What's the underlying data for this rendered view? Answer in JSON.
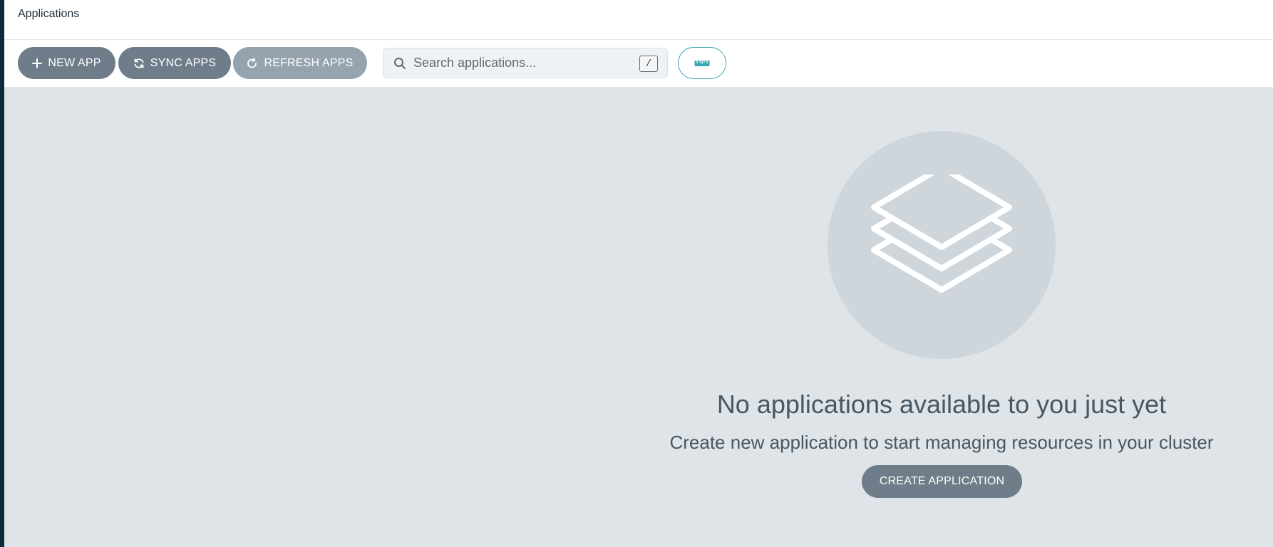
{
  "header": {
    "title": "Applications"
  },
  "toolbar": {
    "new_app_label": "NEW APP",
    "sync_apps_label": "SYNC APPS",
    "refresh_apps_label": "REFRESH APPS",
    "search": {
      "placeholder": "Search applications...",
      "value": "",
      "shortcut_hint": "/"
    },
    "ruler_icon": "ruler-icon"
  },
  "empty_state": {
    "icon": "layers-icon",
    "title": "No applications available to you just yet",
    "subtitle": "Create new application to start managing resources in your cluster",
    "create_label": "CREATE APPLICATION"
  },
  "colors": {
    "primary_button": "#6e7d89",
    "disabled_button": "#95a3ae",
    "accent": "#3aa6b9",
    "background": "#dee4e8"
  }
}
